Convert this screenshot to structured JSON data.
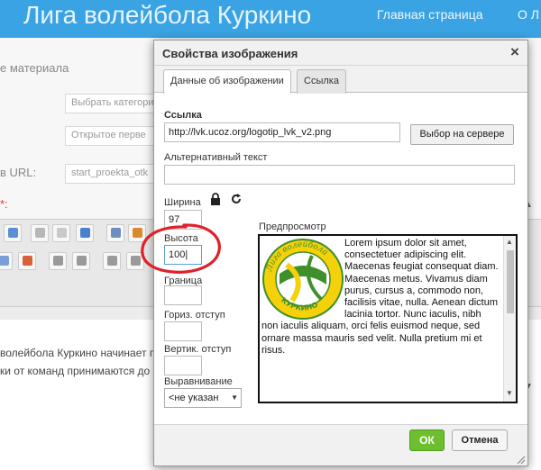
{
  "site": {
    "title": "Лига волейбола Куркино",
    "nav": [
      "Главная страница",
      "О Л"
    ]
  },
  "background": {
    "labels": [
      "е материала",
      "в URL:"
    ],
    "required_mark": "*:",
    "inputs": [
      "Выбрать категори",
      "Открытое перве",
      "start_proekta_otk"
    ],
    "text_lines": [
      "волейбола Куркино начинает п",
      "ки от команд принимаются до"
    ]
  },
  "dialog": {
    "title": "Свойства изображения",
    "close": "×",
    "tabs": [
      "Данные об изображении",
      "Ссылка"
    ],
    "url_label": "Ссылка",
    "url_value": "http://lvk.ucoz.org/logotip_lvk_v2.png",
    "server_button": "Выбор на сервере",
    "alt_label": "Альтернативный текст",
    "alt_value": "",
    "width_label": "Ширина",
    "width_value": "97",
    "height_label": "Высота",
    "height_value": "100|",
    "border_label": "Граница",
    "border_value": "",
    "hspace_label": "Гориз. отступ",
    "hspace_value": "",
    "vspace_label": "Вертик. отступ",
    "vspace_value": "",
    "align_label": "Выравнивание",
    "align_value": "<не указан",
    "preview_label": "Предпросмотр",
    "preview_text": "Lorem ipsum dolor sit amet, consectetuer adipiscing elit. Maecenas feugiat consequat diam. Maecenas metus. Vivamus diam purus, cursus a, commodo non, facilisis vitae, nulla. Aenean dictum lacinia tortor. Nunc iaculis, nibh non iaculis aliquam, orci felis euismod neque, sed ornare massa mauris sed velit. Nulla pretium mi et risus.",
    "logo_text_top": "Лига волейбола",
    "logo_text_bottom": "КУРКИНО",
    "ok_button": "ОК",
    "cancel_button": "Отмена"
  },
  "colors": {
    "header": "#3aa3e3",
    "ok": "#6cbf2e",
    "annotation": "#e0202a",
    "logo_green": "#3f8f2a",
    "logo_yellow": "#f5d10b"
  }
}
